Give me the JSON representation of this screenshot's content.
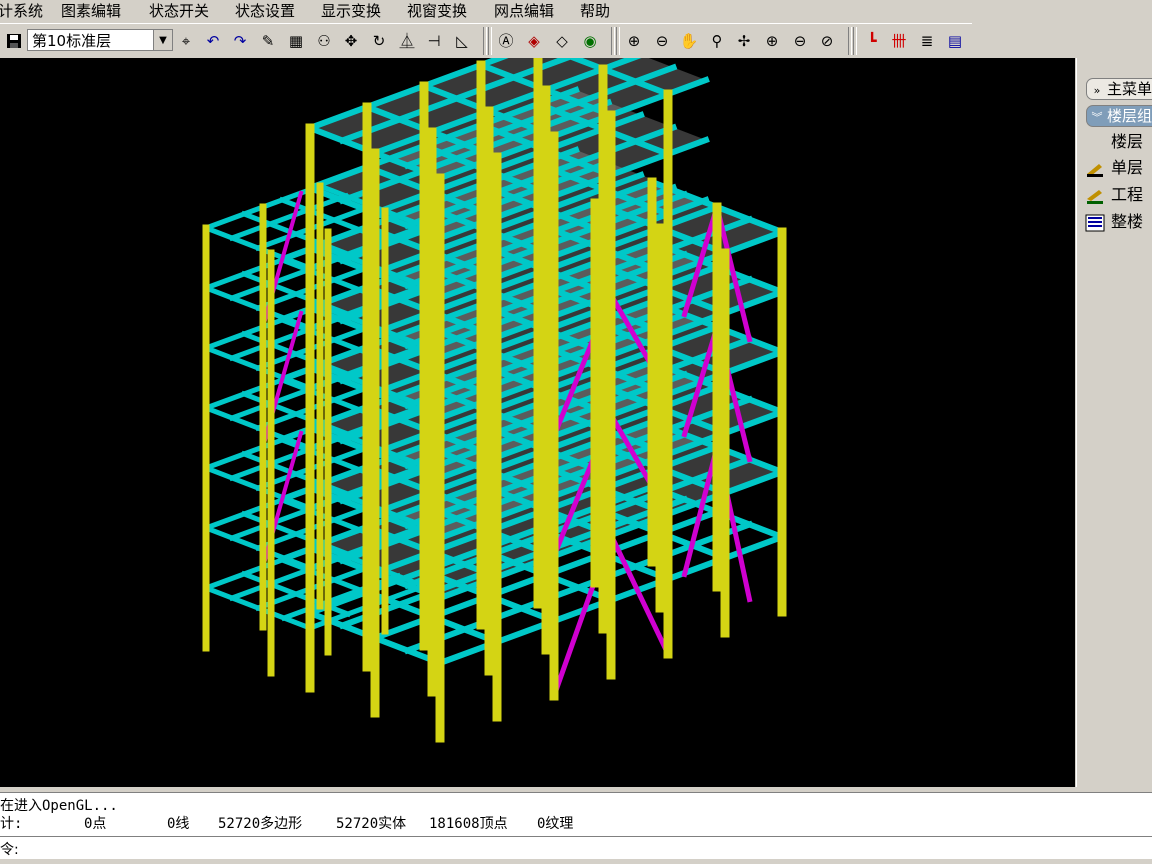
{
  "menu": [
    "计系统",
    "图素编辑",
    "状态开关",
    "状态设置",
    "显示变换",
    "视窗变换",
    "网点编辑",
    "帮助"
  ],
  "toolbar": {
    "floor_select_value": "第10标准层"
  },
  "sidebar": {
    "main_menu_label": "主菜单",
    "floor_group_label": "楼层组",
    "items": [
      "楼层",
      "单层",
      "工程",
      "整楼"
    ]
  },
  "output": {
    "line1": "在进入OpenGL...",
    "stats_label": "计:",
    "stats": [
      "0点",
      "0线",
      "52720多边形",
      "52720实体",
      "181608顶点",
      "0纹理"
    ]
  },
  "command": {
    "prompt": "令:"
  },
  "colors": {
    "columns": "#d4d414",
    "beams": "#00c8c8",
    "braces": "#d000d0",
    "slabs": "#a0a0a0",
    "viewport_bg": "#000000"
  }
}
